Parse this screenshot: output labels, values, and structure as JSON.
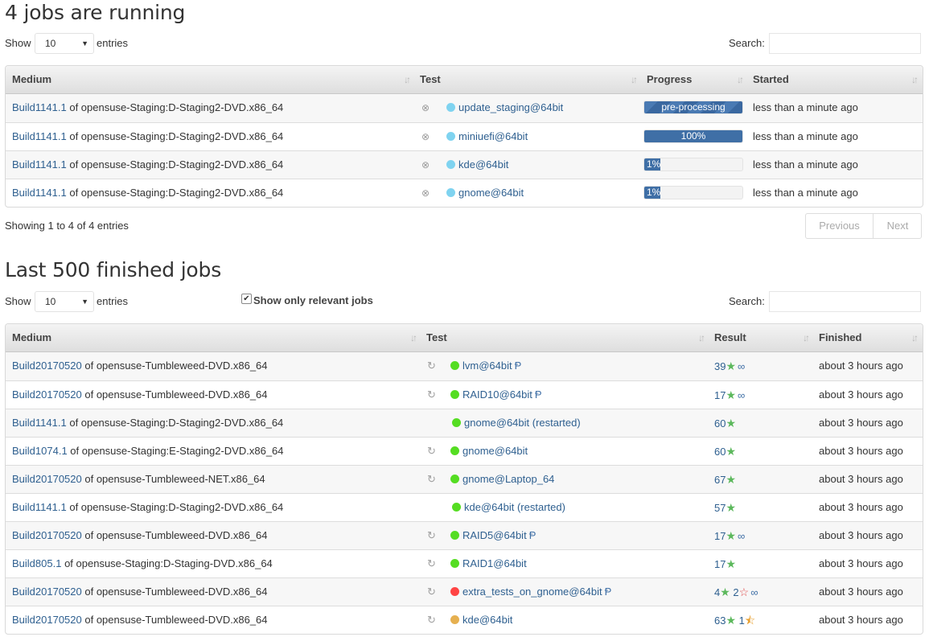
{
  "running": {
    "title": "4 jobs are running",
    "show_label": "Show",
    "length_value": "10",
    "entries_label": "entries",
    "search_label": "Search:",
    "search_value": "",
    "columns": [
      "Medium",
      "Test",
      "Progress",
      "Started"
    ],
    "rows": [
      {
        "build": "Build1141.1",
        "medium": "of opensuse-Staging:D-Staging2-DVD.x86_64",
        "test": "update_staging@64bit",
        "progress_label": "pre-processing",
        "progress": 100,
        "started": "less than a minute ago"
      },
      {
        "build": "Build1141.1",
        "medium": "of opensuse-Staging:D-Staging2-DVD.x86_64",
        "test": "miniuefi@64bit",
        "progress_label": "100%",
        "progress": 100,
        "started": "less than a minute ago"
      },
      {
        "build": "Build1141.1",
        "medium": "of opensuse-Staging:D-Staging2-DVD.x86_64",
        "test": "kde@64bit",
        "progress_label": "1%",
        "progress": 1,
        "started": "less than a minute ago"
      },
      {
        "build": "Build1141.1",
        "medium": "of opensuse-Staging:D-Staging2-DVD.x86_64",
        "test": "gnome@64bit",
        "progress_label": "1%",
        "progress": 1,
        "started": "less than a minute ago"
      }
    ],
    "info": "Showing 1 to 4 of 4 entries",
    "previous_label": "Previous",
    "next_label": "Next",
    "status_color": "#7fd3f0"
  },
  "finished": {
    "title": "Last 500 finished jobs",
    "show_label": "Show",
    "length_value": "10",
    "entries_label": "entries",
    "relevant_label": "Show only relevant jobs",
    "relevant_checked": true,
    "search_label": "Search:",
    "search_value": "",
    "columns": [
      "Medium",
      "Test",
      "Result",
      "Finished"
    ],
    "rows": [
      {
        "build": "Build20170520",
        "medium": "of opensuse-Tumbleweed-DVD.x86_64",
        "test": "lvm@64bit",
        "status": "passed",
        "bug": true,
        "restart": true,
        "passed": "39",
        "failed": "",
        "softfailed": "",
        "linked": true,
        "finished": "about 3 hours ago"
      },
      {
        "build": "Build20170520",
        "medium": "of opensuse-Tumbleweed-DVD.x86_64",
        "test": "RAID10@64bit",
        "status": "passed",
        "bug": true,
        "restart": true,
        "passed": "17",
        "failed": "",
        "softfailed": "",
        "linked": true,
        "finished": "about 3 hours ago"
      },
      {
        "build": "Build1141.1",
        "medium": "of opensuse-Staging:D-Staging2-DVD.x86_64",
        "test": "gnome@64bit (restarted)",
        "status": "passed",
        "bug": false,
        "restart": false,
        "passed": "60",
        "failed": "",
        "softfailed": "",
        "linked": false,
        "finished": "about 3 hours ago"
      },
      {
        "build": "Build1074.1",
        "medium": "of opensuse-Staging:E-Staging2-DVD.x86_64",
        "test": "gnome@64bit",
        "status": "passed",
        "bug": false,
        "restart": true,
        "passed": "60",
        "failed": "",
        "softfailed": "",
        "linked": false,
        "finished": "about 3 hours ago"
      },
      {
        "build": "Build20170520",
        "medium": "of opensuse-Tumbleweed-NET.x86_64",
        "test": "gnome@Laptop_64",
        "status": "passed",
        "bug": false,
        "restart": true,
        "passed": "67",
        "failed": "",
        "softfailed": "",
        "linked": false,
        "finished": "about 3 hours ago"
      },
      {
        "build": "Build1141.1",
        "medium": "of opensuse-Staging:D-Staging2-DVD.x86_64",
        "test": "kde@64bit (restarted)",
        "status": "passed",
        "bug": false,
        "restart": false,
        "passed": "57",
        "failed": "",
        "softfailed": "",
        "linked": false,
        "finished": "about 3 hours ago"
      },
      {
        "build": "Build20170520",
        "medium": "of opensuse-Tumbleweed-DVD.x86_64",
        "test": "RAID5@64bit",
        "status": "passed",
        "bug": true,
        "restart": true,
        "passed": "17",
        "failed": "",
        "softfailed": "",
        "linked": true,
        "finished": "about 3 hours ago"
      },
      {
        "build": "Build805.1",
        "medium": "of opensuse-Staging:D-Staging-DVD.x86_64",
        "test": "RAID1@64bit",
        "status": "passed",
        "bug": false,
        "restart": true,
        "passed": "17",
        "failed": "",
        "softfailed": "",
        "linked": false,
        "finished": "about 3 hours ago"
      },
      {
        "build": "Build20170520",
        "medium": "of opensuse-Tumbleweed-DVD.x86_64",
        "test": "extra_tests_on_gnome@64bit",
        "status": "failed",
        "bug": true,
        "restart": true,
        "passed": "4",
        "failed": "2",
        "softfailed": "",
        "linked": true,
        "finished": "about 3 hours ago"
      },
      {
        "build": "Build20170520",
        "medium": "of opensuse-Tumbleweed-DVD.x86_64",
        "test": "kde@64bit",
        "status": "softfailed",
        "bug": false,
        "restart": true,
        "passed": "63",
        "failed": "",
        "softfailed": "1",
        "linked": false,
        "finished": "about 3 hours ago"
      }
    ],
    "status_colors": {
      "passed": "#55dd22",
      "failed": "#ff4444",
      "softfailed": "#e6b050"
    }
  }
}
